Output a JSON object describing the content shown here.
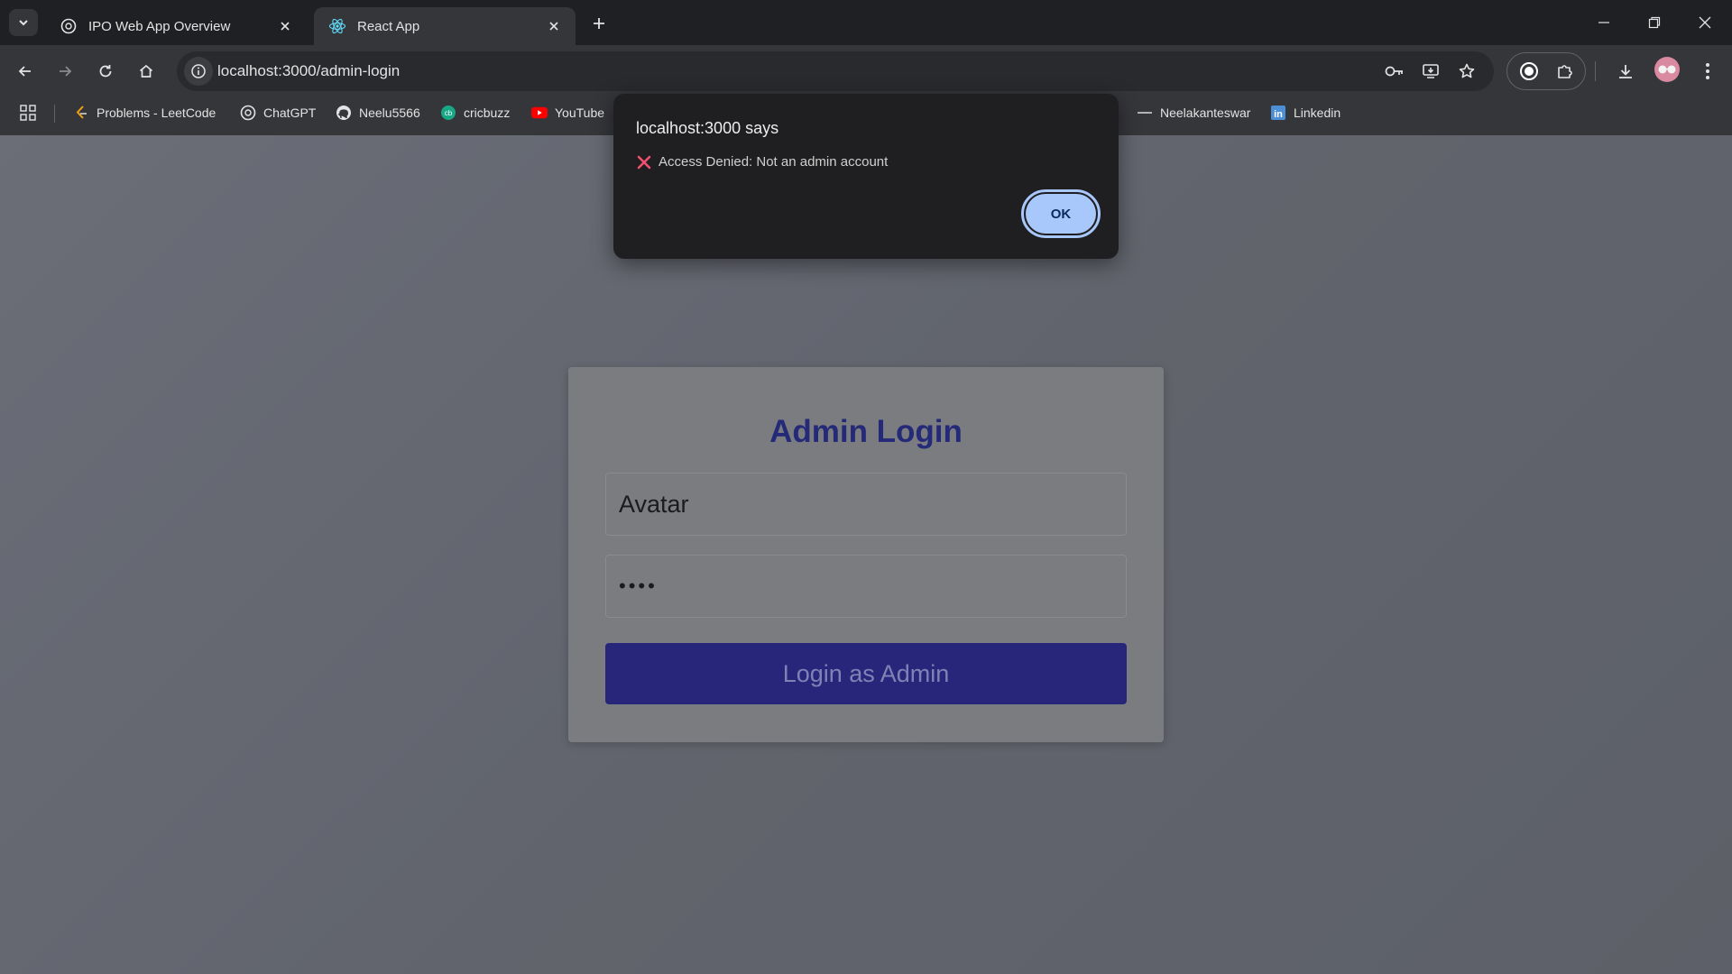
{
  "browser": {
    "tabs": [
      {
        "title": "IPO Web App Overview",
        "active": false
      },
      {
        "title": "React App",
        "active": true
      }
    ],
    "url": "localhost:3000/admin-login",
    "bookmarks": [
      {
        "label": "Problems - LeetCode",
        "icon": "leetcode-icon"
      },
      {
        "label": "ChatGPT",
        "icon": "chatgpt-icon"
      },
      {
        "label": "Neelu5566",
        "icon": "github-icon"
      },
      {
        "label": "cricbuzz",
        "icon": "cricbuzz-icon"
      },
      {
        "label": "YouTube",
        "icon": "youtube-icon"
      },
      {
        "label": "Neelakanteswar",
        "icon": "link-icon"
      },
      {
        "label": "Linkedin",
        "icon": "linkedin-icon"
      }
    ]
  },
  "page": {
    "heading": "Admin Login",
    "username_value": "Avatar",
    "password_value": "••••",
    "login_button": "Login as Admin"
  },
  "dialog": {
    "title": "localhost:3000 says",
    "message": "Access Denied: Not an admin account",
    "ok_label": "OK"
  },
  "colors": {
    "heading": "#252a78",
    "login_button_bg": "#27267a",
    "ok_button_bg": "#a8c7fa"
  }
}
